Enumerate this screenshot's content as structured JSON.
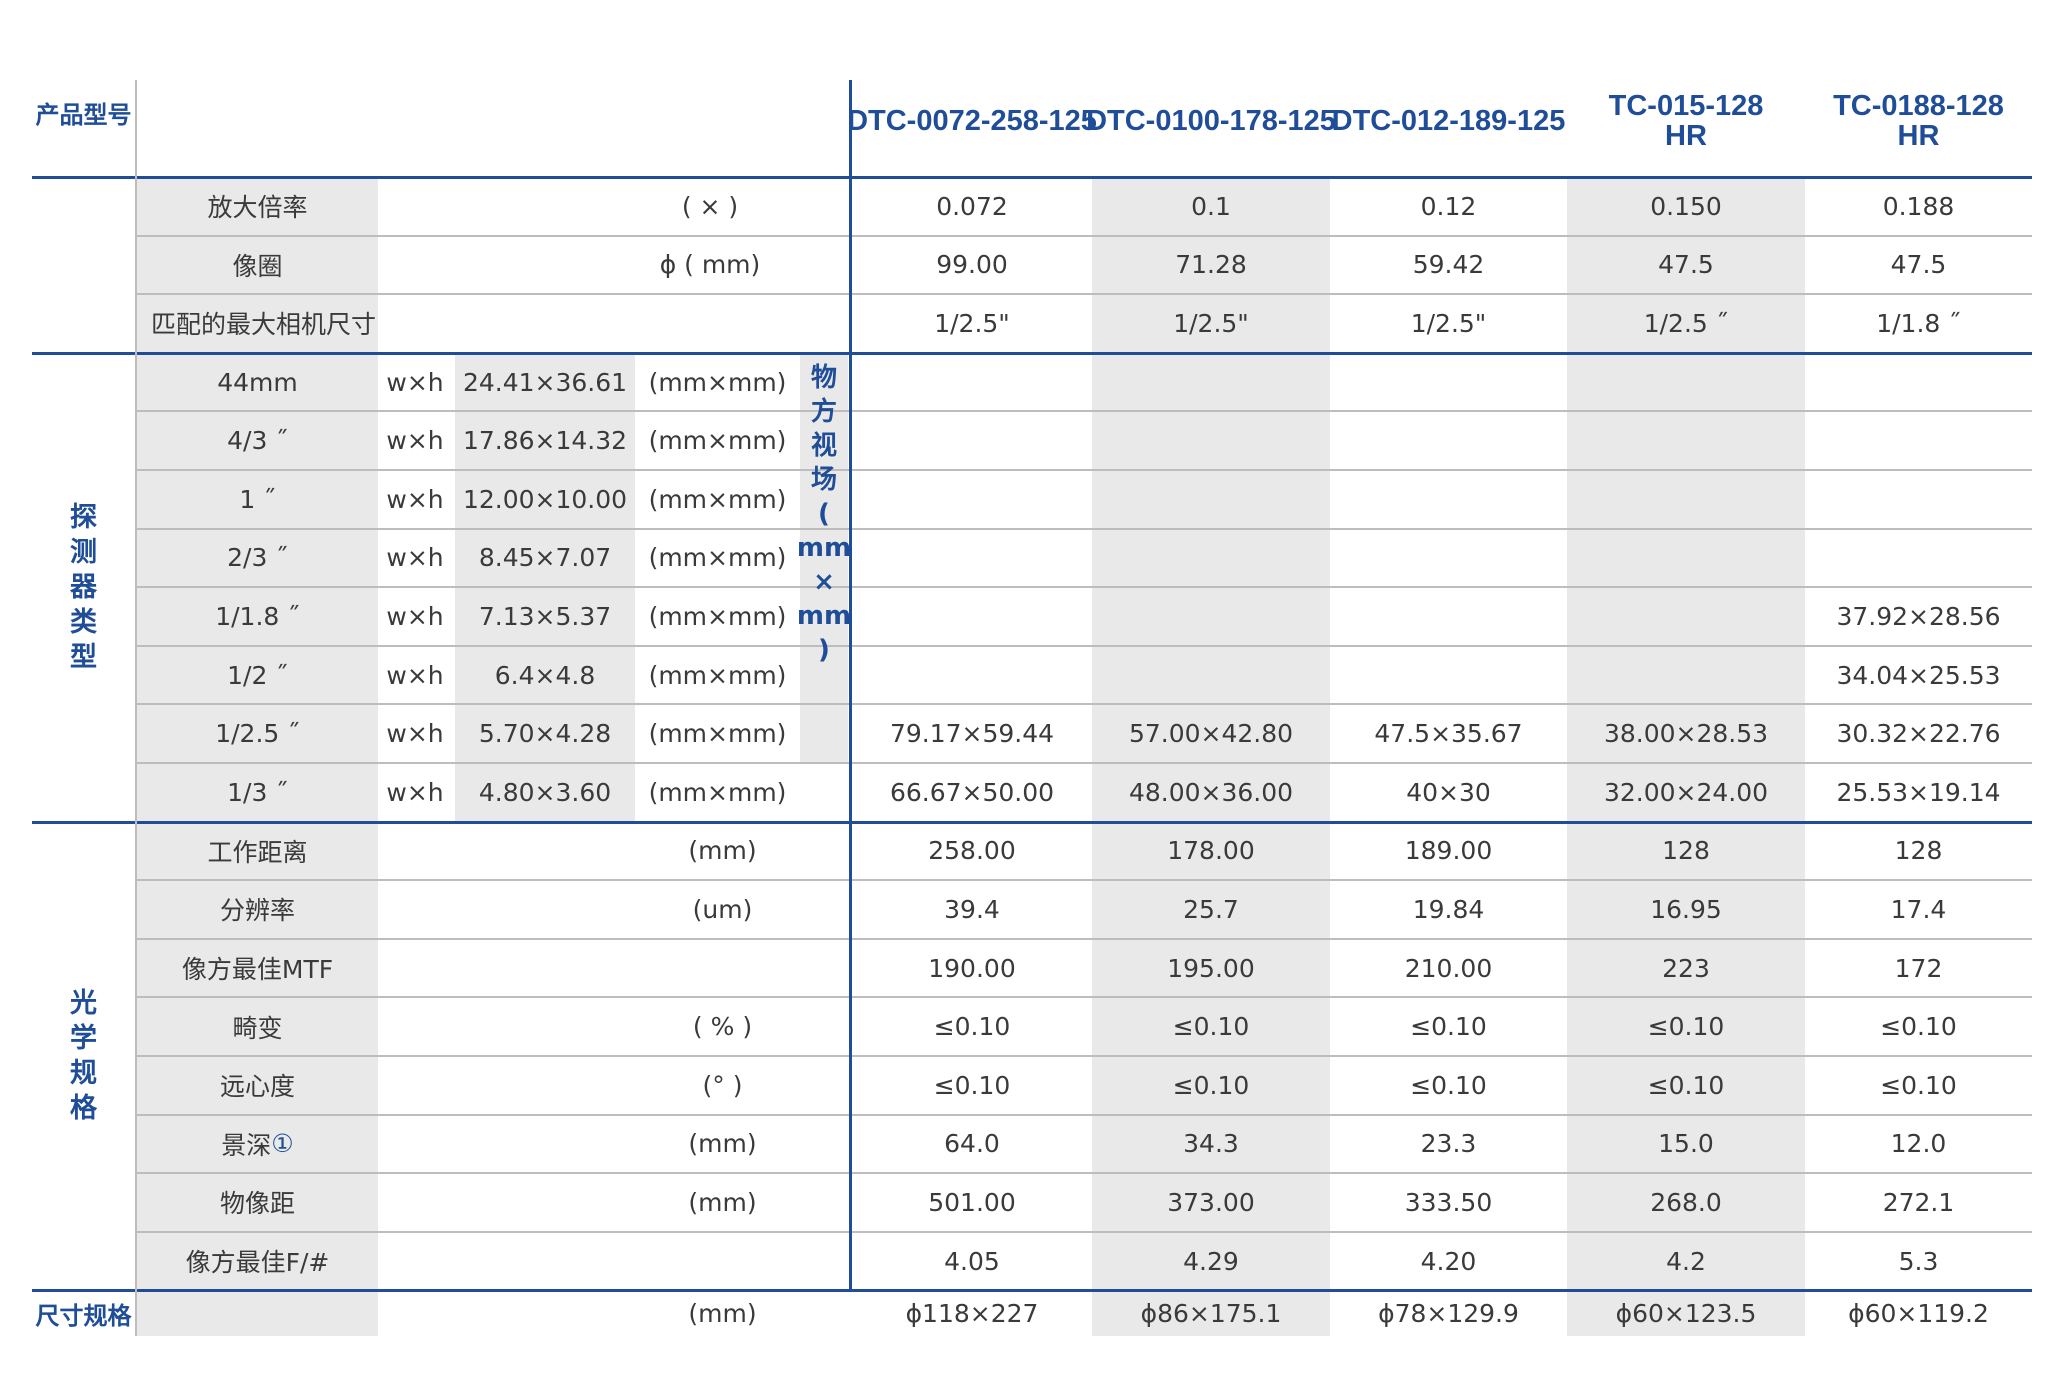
{
  "header": {
    "model_label": "产品型号",
    "models": [
      {
        "line1": "DTC-0072-258-125",
        "line2": ""
      },
      {
        "line1": "DTC-0100-178-125",
        "line2": ""
      },
      {
        "line1": "DTC-012-189-125",
        "line2": ""
      },
      {
        "line1": "TC-015-128",
        "line2": "HR"
      },
      {
        "line1": "TC-0188-128",
        "line2": "HR"
      }
    ]
  },
  "sections": {
    "detector": [
      "探",
      "测",
      "器",
      "类",
      "型"
    ],
    "optical": [
      "光",
      "学",
      "规",
      "格"
    ],
    "size": "尺寸规格"
  },
  "fov_label": [
    "物",
    "方",
    "视",
    "场",
    "(",
    "mm",
    "×",
    "mm",
    ")"
  ],
  "basic_rows": [
    {
      "name": "放大倍率",
      "unit": "( × )",
      "values": [
        "0.072",
        "0.1",
        "0.12",
        "0.150",
        "0.188"
      ]
    },
    {
      "name": "像圈",
      "unit": "ϕ ( mm)",
      "values": [
        "99.00",
        "71.28",
        "59.42",
        "47.5",
        "47.5"
      ]
    },
    {
      "name": "匹配的最大相机尺寸",
      "unit": "",
      "values": [
        "1/2.5\"",
        "1/2.5\"",
        "1/2.5\"",
        "1/2.5 ˝",
        "1/1.8 ˝"
      ]
    }
  ],
  "detector_rows": [
    {
      "name": "44mm",
      "wh": "w×h",
      "dims": "24.41×36.61",
      "unit": "(mm×mm)",
      "values": [
        "",
        "",
        "",
        "",
        ""
      ]
    },
    {
      "name": "4/3 ˝",
      "wh": "w×h",
      "dims": "17.86×14.32",
      "unit": "(mm×mm)",
      "values": [
        "",
        "",
        "",
        "",
        ""
      ]
    },
    {
      "name": "1 ˝",
      "wh": "w×h",
      "dims": "12.00×10.00",
      "unit": "(mm×mm)",
      "values": [
        "",
        "",
        "",
        "",
        ""
      ]
    },
    {
      "name": "2/3 ˝",
      "wh": "w×h",
      "dims": "8.45×7.07",
      "unit": "(mm×mm)",
      "values": [
        "",
        "",
        "",
        "",
        ""
      ]
    },
    {
      "name": "1/1.8 ˝",
      "wh": "w×h",
      "dims": "7.13×5.37",
      "unit": "(mm×mm)",
      "values": [
        "",
        "",
        "",
        "",
        "37.92×28.56"
      ]
    },
    {
      "name": "1/2 ˝",
      "wh": "w×h",
      "dims": "6.4×4.8",
      "unit": "(mm×mm)",
      "values": [
        "",
        "",
        "",
        "",
        "34.04×25.53"
      ]
    },
    {
      "name": "1/2.5 ˝",
      "wh": "w×h",
      "dims": "5.70×4.28",
      "unit": "(mm×mm)",
      "values": [
        "79.17×59.44",
        "57.00×42.80",
        "47.5×35.67",
        "38.00×28.53",
        "30.32×22.76"
      ]
    },
    {
      "name": "1/3 ˝",
      "wh": "w×h",
      "dims": "4.80×3.60",
      "unit": "(mm×mm)",
      "values": [
        "66.67×50.00",
        "48.00×36.00",
        "40×30",
        "32.00×24.00",
        "25.53×19.14"
      ]
    }
  ],
  "optical_rows": [
    {
      "name": "工作距离",
      "unit": "(mm)",
      "values": [
        "258.00",
        "178.00",
        "189.00",
        "128",
        "128"
      ]
    },
    {
      "name": "分辨率",
      "unit": "(um)",
      "values": [
        "39.4",
        "25.7",
        "19.84",
        "16.95",
        "17.4"
      ]
    },
    {
      "name": "像方最佳MTF",
      "unit": "",
      "values": [
        "190.00",
        "195.00",
        "210.00",
        "223",
        "172"
      ]
    },
    {
      "name": "畸变",
      "unit": "( % )",
      "values": [
        "≤0.10",
        "≤0.10",
        "≤0.10",
        "≤0.10",
        "≤0.10"
      ]
    },
    {
      "name": "远心度",
      "unit": "(° )",
      "values": [
        "≤0.10",
        "≤0.10",
        "≤0.10",
        "≤0.10",
        "≤0.10"
      ]
    },
    {
      "name": "景深",
      "note": "①",
      "unit": "(mm)",
      "values": [
        "64.0",
        "34.3",
        "23.3",
        "15.0",
        "12.0"
      ]
    },
    {
      "name": "物像距",
      "unit": "(mm)",
      "values": [
        "501.00",
        "373.00",
        "333.50",
        "268.0",
        "272.1"
      ]
    },
    {
      "name": "像方最佳F/#",
      "unit": "",
      "values": [
        "4.05",
        "4.29",
        "4.20",
        "4.2",
        "5.3"
      ]
    }
  ],
  "size_row": {
    "unit": "(mm)",
    "values": [
      "ϕ118×227",
      "ϕ86×175.1",
      "ϕ78×129.9",
      "ϕ60×123.5",
      "ϕ60×119.2"
    ]
  },
  "colors": {
    "accent": "#1f4d97",
    "shade": "#e9e9ea",
    "rule": "#bdbdbd",
    "text": "#3a3a3a"
  }
}
